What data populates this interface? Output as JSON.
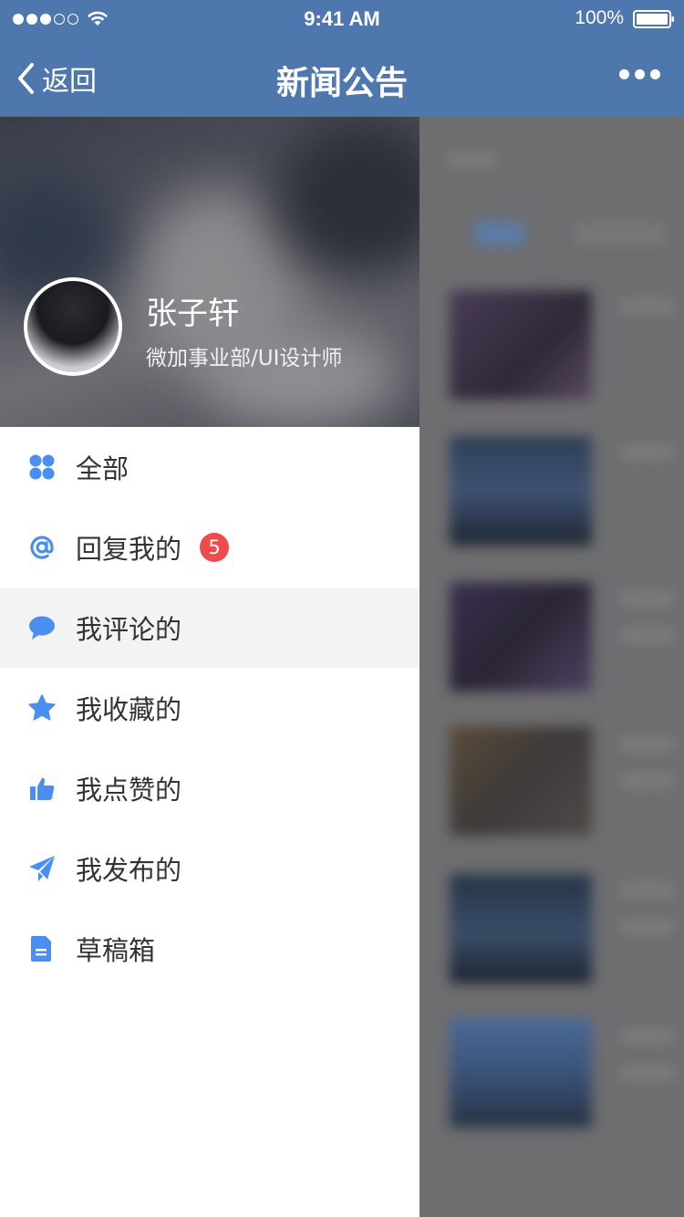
{
  "status_bar": {
    "time": "9:41 AM",
    "battery": "100%"
  },
  "nav": {
    "back_label": "返回",
    "title": "新闻公告"
  },
  "profile": {
    "name": "张子轩",
    "department": "微加事业部/UI设计师"
  },
  "menu": {
    "items": [
      {
        "label": "全部",
        "icon": "grid-icon"
      },
      {
        "label": "回复我的",
        "icon": "at-icon",
        "badge": "5"
      },
      {
        "label": "我评论的",
        "icon": "comment-icon",
        "active": true
      },
      {
        "label": "我收藏的",
        "icon": "star-icon"
      },
      {
        "label": "我点赞的",
        "icon": "thumbs-up-icon"
      },
      {
        "label": "我发布的",
        "icon": "paper-plane-icon"
      },
      {
        "label": "草稿箱",
        "icon": "document-icon"
      }
    ]
  },
  "colors": {
    "nav": "#4d77ad",
    "accent": "#4a8ff0",
    "badge": "#f04a4a",
    "active_row": "#f3f3f3"
  }
}
